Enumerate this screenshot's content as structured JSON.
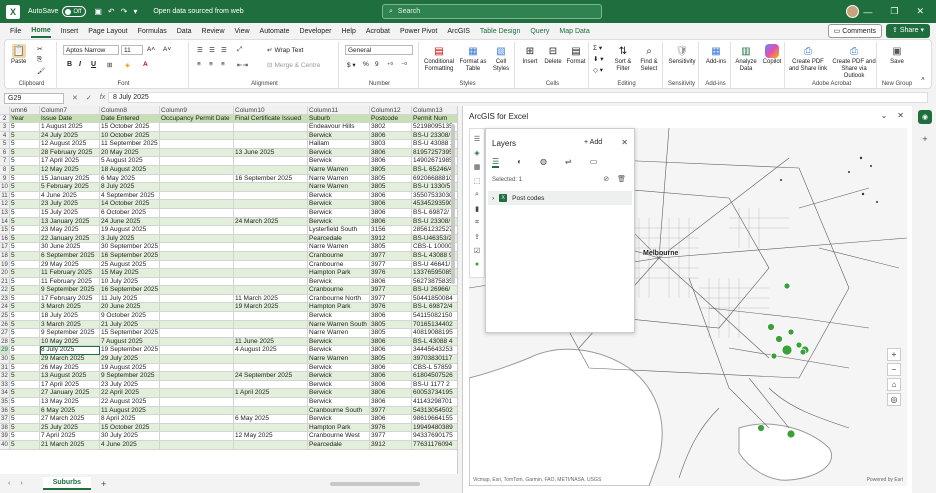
{
  "titlebar": {
    "autosave_label": "AutoSave",
    "autosave_state": "Off",
    "doc_name": "Open data sourced from web",
    "search_placeholder": "Search"
  },
  "menu": {
    "tabs": [
      "File",
      "Home",
      "Insert",
      "Page Layout",
      "Formulas",
      "Data",
      "Review",
      "View",
      "Automate",
      "Developer",
      "Help",
      "Acrobat",
      "Power Pivot",
      "ArcGIS",
      "Table Design",
      "Query",
      "Map Data"
    ],
    "active": "Home",
    "comments": "Comments",
    "share": "Share"
  },
  "ribbon": {
    "clipboard": {
      "label": "Clipboard",
      "paste": "Paste"
    },
    "font": {
      "label": "Font",
      "name": "Aptos Narrow",
      "size": "11"
    },
    "alignment": {
      "label": "Alignment",
      "wrap": "Wrap Text",
      "merge": "Merge & Centre"
    },
    "number": {
      "label": "Number",
      "format": "General"
    },
    "styles": {
      "label": "Styles",
      "conditional": "Conditional Formatting",
      "format_table": "Format as Table",
      "cell_styles": "Cell Styles"
    },
    "cells": {
      "label": "Cells",
      "insert": "Insert",
      "delete": "Delete",
      "format": "Format"
    },
    "editing": {
      "label": "Editing",
      "sort": "Sort & Filter",
      "find": "Find & Select"
    },
    "sensitivity": {
      "label": "Sensitivity",
      "btn": "Sensitivity"
    },
    "addins": {
      "label": "Add-ins",
      "btn": "Add-ins"
    },
    "analyze": {
      "btn": "Analyze Data"
    },
    "copilot": {
      "btn": "Copilot"
    },
    "adobe": {
      "label": "Adobe Acrobat",
      "pdf_link": "Create PDF and Share link",
      "pdf_outlook": "Create PDF and Share via Outlook"
    },
    "newgroup": {
      "label": "New Group",
      "save": "Save"
    }
  },
  "formula": {
    "namebox": "G29",
    "value": "8 July 2025"
  },
  "grid": {
    "col_letters": [
      "umn6",
      "Column7",
      "Column8",
      "Column9",
      "Column10",
      "Column11",
      "Column12",
      "Column13"
    ],
    "headers": [
      "Year",
      "Issue Date",
      "Date Entered",
      "Occupancy Permit Date",
      "Final Certificate Issued",
      "Suburb",
      "Postcode",
      "Permit Num"
    ],
    "rows": [
      {
        "n": "3",
        "c": [
          "5",
          "1 August 2025",
          "15 October 2025",
          "",
          "",
          "Endeavour Hills",
          "3802",
          "52198095135"
        ]
      },
      {
        "n": "4",
        "c": [
          "5",
          "24 July 2025",
          "10 October 2025",
          "",
          "",
          "Berwick",
          "3806",
          "BS-U 23308/"
        ]
      },
      {
        "n": "5",
        "c": [
          "5",
          "12 August 2025",
          "11 September 2025",
          "",
          "",
          "Hallam",
          "3803",
          "BS-U 43088 2"
        ]
      },
      {
        "n": "6",
        "c": [
          "5",
          "28 February 2025",
          "20 May 2025",
          "",
          "13 June 2025",
          "Berwick",
          "3806",
          "81957257395"
        ]
      },
      {
        "n": "7",
        "c": [
          "5",
          "17 April 2025",
          "5 August 2025",
          "",
          "",
          "Berwick",
          "3806",
          "14902671985"
        ]
      },
      {
        "n": "8",
        "c": [
          "5",
          "12 May 2025",
          "18 August 2025",
          "",
          "",
          "Narre Warren",
          "3805",
          "BS-L 65246/4"
        ]
      },
      {
        "n": "9",
        "c": [
          "5",
          "15 January 2025",
          "6 May 2025",
          "",
          "16 September 2025",
          "Narre Warren",
          "3805",
          "69206688810"
        ]
      },
      {
        "n": "10",
        "c": [
          "5",
          "5 February 2025",
          "8 July 2025",
          "",
          "",
          "Narre Warren",
          "3805",
          "BS-U 1330/5"
        ]
      },
      {
        "n": "11",
        "c": [
          "5",
          "4 June 2025",
          "4 September 2025",
          "",
          "",
          "Berwick",
          "3806",
          "35507533030"
        ]
      },
      {
        "n": "12",
        "c": [
          "5",
          "23 July 2025",
          "14 October 2025",
          "",
          "",
          "Berwick",
          "3806",
          "45345293590"
        ]
      },
      {
        "n": "13",
        "c": [
          "5",
          "15 July 2025",
          "6 October 2025",
          "",
          "",
          "Berwick",
          "3806",
          "BS-L 69872/"
        ]
      },
      {
        "n": "14",
        "c": [
          "5",
          "13 January 2025",
          "24 June 2025",
          "",
          "24 March 2025",
          "Berwick",
          "3806",
          "BS-U 23308/"
        ]
      },
      {
        "n": "15",
        "c": [
          "5",
          "23 May 2025",
          "19 August 2025",
          "",
          "",
          "Lysterfield South",
          "3156",
          "28561232527"
        ]
      },
      {
        "n": "16",
        "c": [
          "5",
          "22 January 2025",
          "3 July 2025",
          "",
          "",
          "Pearcedale",
          "3912",
          "BS-U46353/2"
        ]
      },
      {
        "n": "17",
        "c": [
          "5",
          "30 June 2025",
          "30 September 2025",
          "",
          "",
          "Narre Warren",
          "3805",
          "CBS-L 10000"
        ]
      },
      {
        "n": "18",
        "c": [
          "5",
          "6 September 2025",
          "16 September 2025",
          "",
          "",
          "Cranbourne",
          "3977",
          "BS-L 43088 9"
        ]
      },
      {
        "n": "19",
        "c": [
          "5",
          "29 May 2025",
          "25 August 2025",
          "",
          "",
          "Cranbourne",
          "3977",
          "BS-U 46641/"
        ]
      },
      {
        "n": "20",
        "c": [
          "5",
          "11 February 2025",
          "15 May 2025",
          "",
          "",
          "Hampton Park",
          "3976",
          "13376595085"
        ]
      },
      {
        "n": "21",
        "c": [
          "5",
          "11 February 2025",
          "10 July 2025",
          "",
          "",
          "Berwick",
          "3806",
          "56273875835"
        ]
      },
      {
        "n": "22",
        "c": [
          "5",
          "9 September 2025",
          "16 September 2025",
          "",
          "",
          "Cranbourne",
          "3977",
          "BS-U 26966/"
        ]
      },
      {
        "n": "23",
        "c": [
          "5",
          "17 February 2025",
          "11 July 2025",
          "",
          "11 March 2025",
          "Cranbourne North",
          "3977",
          "50441850084"
        ]
      },
      {
        "n": "24",
        "c": [
          "5",
          "3 March 2025",
          "20 June 2025",
          "",
          "19 March 2025",
          "Hampton Park",
          "3976",
          "BS-L 69872/4"
        ]
      },
      {
        "n": "25",
        "c": [
          "5",
          "18 July 2025",
          "9 October 2025",
          "",
          "",
          "Berwick",
          "3806",
          "54115082150"
        ]
      },
      {
        "n": "26",
        "c": [
          "5",
          "3 March 2025",
          "21 July 2025",
          "",
          "",
          "Narre Warren South",
          "3805",
          "70165134402"
        ]
      },
      {
        "n": "27",
        "c": [
          "5",
          "9 September 2025",
          "15 September 2025",
          "",
          "",
          "Narre Warren",
          "3805",
          "40819088195"
        ]
      },
      {
        "n": "28",
        "c": [
          "5",
          "10 May 2025",
          "7 August 2025",
          "",
          "11 June 2025",
          "Berwick",
          "3806",
          "BS-L 43088 4"
        ]
      },
      {
        "n": "29",
        "c": [
          "5",
          "8 July 2025",
          "19 September 2025",
          "",
          "4 August 2025",
          "Berwick",
          "3806",
          "34445643253"
        ]
      },
      {
        "n": "30",
        "c": [
          "5",
          "29 March 2025",
          "29 July 2025",
          "",
          "",
          "Narre Warren",
          "3805",
          "39703830117"
        ]
      },
      {
        "n": "31",
        "c": [
          "5",
          "26 May 2025",
          "19 August 2025",
          "",
          "",
          "Berwick",
          "3806",
          "CBS-L 57859"
        ]
      },
      {
        "n": "32",
        "c": [
          "5",
          "13 August 2025",
          "9 September 2025",
          "",
          "24 September 2025",
          "Berwick",
          "3806",
          "61804507526"
        ]
      },
      {
        "n": "33",
        "c": [
          "5",
          "17 April 2025",
          "23 July 2025",
          "",
          "",
          "Berwick",
          "3806",
          "BS-U 1177 2"
        ]
      },
      {
        "n": "34",
        "c": [
          "5",
          "27 January 2025",
          "22 April 2025",
          "",
          "1 April 2025",
          "Berwick",
          "3806",
          "60053734195"
        ]
      },
      {
        "n": "35",
        "c": [
          "5",
          "13 May 2025",
          "22 August 2025",
          "",
          "",
          "Berwick",
          "3806",
          "41143298701"
        ]
      },
      {
        "n": "36",
        "c": [
          "5",
          "6 May 2025",
          "11 August 2025",
          "",
          "",
          "Cranbourne South",
          "3977",
          "54313054502"
        ]
      },
      {
        "n": "37",
        "c": [
          "5",
          "27 March 2025",
          "8 April 2025",
          "",
          "6 May 2025",
          "Berwick",
          "3806",
          "98619664155"
        ]
      },
      {
        "n": "38",
        "c": [
          "5",
          "25 July 2025",
          "15 October 2025",
          "",
          "",
          "Hampton Park",
          "3976",
          "19949480389"
        ]
      },
      {
        "n": "39",
        "c": [
          "5",
          "7 April 2025",
          "30 July 2025",
          "",
          "12 May 2025",
          "Cranbourne West",
          "3977",
          "94337690175"
        ]
      },
      {
        "n": "40",
        "c": [
          "5",
          "21 March 2025",
          "4 June 2025",
          "",
          "",
          "Pearcedale",
          "3912",
          "77631176094"
        ]
      }
    ]
  },
  "sheet": {
    "tab": "Suburbs"
  },
  "arcgis": {
    "title": "ArcGIS for Excel",
    "layers_title": "Layers",
    "add": "Add",
    "selected": "Selected: 1",
    "layer_name": "Post codes",
    "city_label": "Melbourne",
    "attribution": "Vicmap, Esri, TomTom, Garmin, FAO, METI/NASA, USGS",
    "powered": "Powered by Esri"
  }
}
